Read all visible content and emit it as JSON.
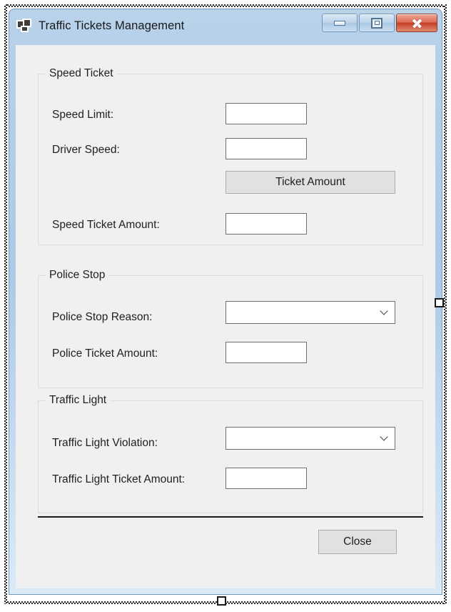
{
  "window": {
    "title": "Traffic Tickets Management",
    "icon": "winforms-app-icon",
    "controls": {
      "minimize_label": "Minimize",
      "maximize_label": "Maximize",
      "close_label": "Close"
    },
    "colors": {
      "frame": "#adc9e5",
      "client_background": "#f0f0f0",
      "close_button": "#c54027",
      "textbox_border": "#707070",
      "group_border": "#dcdcdc",
      "button_face": "#e1e1e1"
    }
  },
  "groups": {
    "speed_ticket": {
      "title": "Speed Ticket",
      "fields": [
        {
          "label": "Speed Limit:",
          "value": "",
          "type": "textbox"
        },
        {
          "label": "Driver Speed:",
          "value": "",
          "type": "textbox"
        },
        {
          "label": "Speed Ticket Amount:",
          "value": "",
          "type": "textbox"
        }
      ],
      "button_label": "Ticket Amount"
    },
    "police_stop": {
      "title": "Police Stop",
      "fields": [
        {
          "label": "Police Stop Reason:",
          "value": "",
          "type": "combobox"
        },
        {
          "label": "Police Ticket Amount:",
          "value": "",
          "type": "textbox"
        }
      ]
    },
    "traffic_light": {
      "title": "Traffic Light",
      "fields": [
        {
          "label": "Traffic Light Violation:",
          "value": "",
          "type": "combobox"
        },
        {
          "label": "Traffic Light Ticket Amount:",
          "value": "",
          "type": "textbox"
        }
      ]
    }
  },
  "footer": {
    "close_label": "Close"
  }
}
